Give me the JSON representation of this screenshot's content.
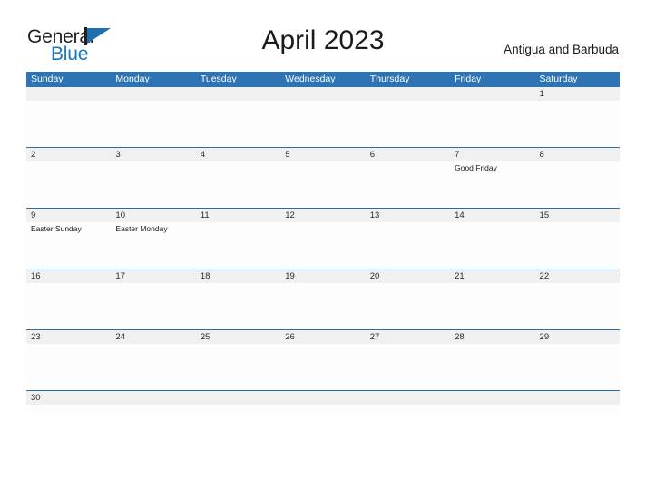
{
  "brand": {
    "word_one": "General",
    "word_two": "Blue",
    "flag_icon": "flag-triangle-icon",
    "primary_color": "#1878be",
    "dark_color": "#231f20"
  },
  "header": {
    "title": "April 2023",
    "country": "Antigua and Barbuda"
  },
  "calendar": {
    "header_color": "#2e74b5",
    "daynum_band_color": "#f0f0f0",
    "rule_color": "#2e6da4",
    "weekdays": [
      "Sunday",
      "Monday",
      "Tuesday",
      "Wednesday",
      "Thursday",
      "Friday",
      "Saturday"
    ],
    "weeks": [
      {
        "short": false,
        "days": [
          {
            "num": "",
            "events": []
          },
          {
            "num": "",
            "events": []
          },
          {
            "num": "",
            "events": []
          },
          {
            "num": "",
            "events": []
          },
          {
            "num": "",
            "events": []
          },
          {
            "num": "",
            "events": []
          },
          {
            "num": "1",
            "events": []
          }
        ]
      },
      {
        "short": false,
        "days": [
          {
            "num": "2",
            "events": []
          },
          {
            "num": "3",
            "events": []
          },
          {
            "num": "4",
            "events": []
          },
          {
            "num": "5",
            "events": []
          },
          {
            "num": "6",
            "events": []
          },
          {
            "num": "7",
            "events": [
              "Good Friday"
            ]
          },
          {
            "num": "8",
            "events": []
          }
        ]
      },
      {
        "short": false,
        "days": [
          {
            "num": "9",
            "events": [
              "Easter Sunday"
            ]
          },
          {
            "num": "10",
            "events": [
              "Easter Monday"
            ]
          },
          {
            "num": "11",
            "events": []
          },
          {
            "num": "12",
            "events": []
          },
          {
            "num": "13",
            "events": []
          },
          {
            "num": "14",
            "events": []
          },
          {
            "num": "15",
            "events": []
          }
        ]
      },
      {
        "short": false,
        "days": [
          {
            "num": "16",
            "events": []
          },
          {
            "num": "17",
            "events": []
          },
          {
            "num": "18",
            "events": []
          },
          {
            "num": "19",
            "events": []
          },
          {
            "num": "20",
            "events": []
          },
          {
            "num": "21",
            "events": []
          },
          {
            "num": "22",
            "events": []
          }
        ]
      },
      {
        "short": false,
        "days": [
          {
            "num": "23",
            "events": []
          },
          {
            "num": "24",
            "events": []
          },
          {
            "num": "25",
            "events": []
          },
          {
            "num": "26",
            "events": []
          },
          {
            "num": "27",
            "events": []
          },
          {
            "num": "28",
            "events": []
          },
          {
            "num": "29",
            "events": []
          }
        ]
      },
      {
        "short": true,
        "days": [
          {
            "num": "30",
            "events": []
          },
          {
            "num": "",
            "events": []
          },
          {
            "num": "",
            "events": []
          },
          {
            "num": "",
            "events": []
          },
          {
            "num": "",
            "events": []
          },
          {
            "num": "",
            "events": []
          },
          {
            "num": "",
            "events": []
          }
        ]
      }
    ]
  }
}
